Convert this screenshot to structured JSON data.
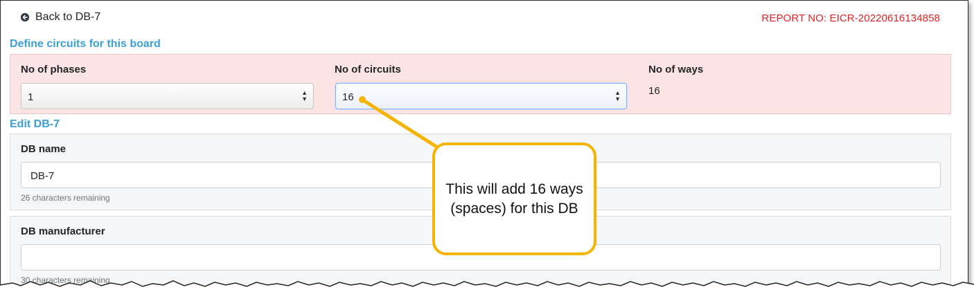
{
  "nav": {
    "back_label": "Back to DB-7",
    "back_icon": "arrow-left-circle-icon"
  },
  "report": {
    "label": "REPORT NO: EICR-20220616134858",
    "color": "#e02424"
  },
  "define_section": {
    "title": "Define circuits for this board",
    "phases": {
      "label": "No of phases",
      "value": "1"
    },
    "circuits": {
      "label": "No of circuits",
      "value": "16"
    },
    "ways": {
      "label": "No of ways",
      "value": "16"
    }
  },
  "edit_section": {
    "title": "Edit DB-7",
    "db_name": {
      "label": "DB name",
      "value": "DB-7",
      "hint": "26 characters remaining"
    },
    "db_manufacturer": {
      "label": "DB manufacturer",
      "value": "",
      "hint": "30 characters remaining"
    }
  },
  "callout": {
    "text": "This will add 16 ways (spaces) for this DB",
    "border_color": "#f4b400"
  },
  "colors": {
    "section_title": "#3b9fd8",
    "panel_pink": "#fde4e4",
    "card_grey": "#f5f6f7"
  }
}
